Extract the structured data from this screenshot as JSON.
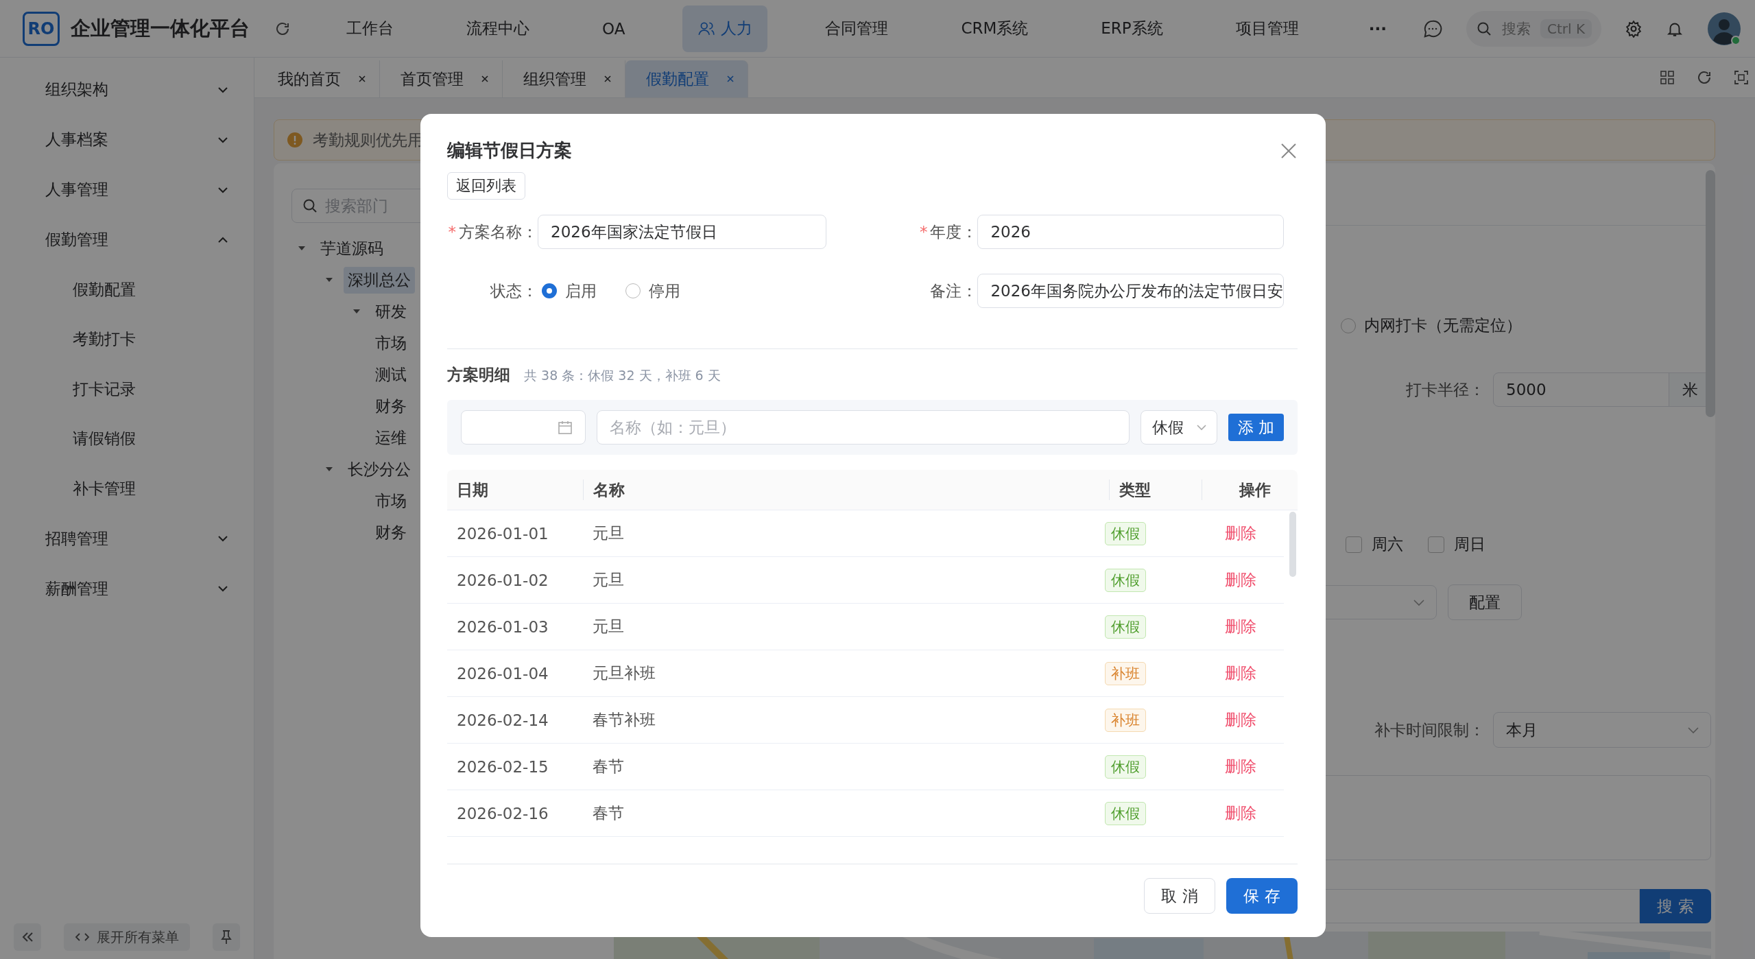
{
  "app": {
    "logo": "RO",
    "title": "企业管理一体化平台"
  },
  "top_nav": [
    {
      "label": "工作台",
      "kind": "text",
      "selected": false
    },
    {
      "label": "流程中心",
      "kind": "text",
      "selected": false
    },
    {
      "label": "OA",
      "kind": "text",
      "selected": false
    },
    {
      "label": "人力",
      "kind": "with-icon",
      "selected": true
    },
    {
      "label": "合同管理",
      "kind": "text",
      "selected": false
    },
    {
      "label": "CRM系统",
      "kind": "text",
      "selected": false
    },
    {
      "label": "ERP系统",
      "kind": "text",
      "selected": false
    },
    {
      "label": "项目管理",
      "kind": "text",
      "selected": false
    },
    {
      "label": "···",
      "kind": "more",
      "selected": false
    }
  ],
  "search": {
    "placeholder": "搜索",
    "shortcut": "Ctrl K"
  },
  "tabs": [
    {
      "label": "我的首页",
      "selected": false
    },
    {
      "label": "首页管理",
      "selected": false
    },
    {
      "label": "组织管理",
      "selected": false
    },
    {
      "label": "假勤配置",
      "selected": true
    }
  ],
  "sidebar": {
    "items": [
      {
        "label": "组织架构",
        "expanded": false
      },
      {
        "label": "人事档案",
        "expanded": false
      },
      {
        "label": "人事管理",
        "expanded": false
      },
      {
        "label": "假勤管理",
        "expanded": true,
        "children": [
          {
            "label": "假勤配置"
          },
          {
            "label": "考勤打卡"
          },
          {
            "label": "打卡记录"
          },
          {
            "label": "请假销假"
          },
          {
            "label": "补卡管理"
          }
        ]
      },
      {
        "label": "招聘管理",
        "expanded": false
      },
      {
        "label": "薪酬管理",
        "expanded": false
      }
    ],
    "expand_all": "展开所有菜单"
  },
  "page": {
    "notice": "考勤规则优先用",
    "dept_search": {
      "placeholder": "搜索部门"
    },
    "dept_tree": [
      {
        "label": "芋道源码",
        "expanded": true,
        "selected": false,
        "children": [
          {
            "label": "深圳总公",
            "expanded": true,
            "selected": true,
            "children": [
              {
                "label": "研发",
                "expanded": true,
                "selected": false
              },
              {
                "label": "市场",
                "selected": false
              },
              {
                "label": "测试",
                "selected": false
              },
              {
                "label": "财务",
                "selected": false
              },
              {
                "label": "运维",
                "selected": false
              }
            ]
          },
          {
            "label": "长沙分公",
            "expanded": true,
            "selected": false,
            "children": [
              {
                "label": "市场",
                "selected": false
              },
              {
                "label": "财务",
                "selected": false
              }
            ]
          }
        ]
      }
    ],
    "checkin_mode": {
      "label": "内网打卡（无需定位）",
      "selected": false
    },
    "radius": {
      "label": "打卡半径：",
      "value": "5000",
      "unit": "米"
    },
    "weekend": [
      {
        "label": "周六",
        "checked": false
      },
      {
        "label": "周日",
        "checked": false
      }
    ],
    "config_button": "配置",
    "makeup_limit": {
      "label": "补卡时间限制：",
      "value": "本月"
    },
    "map_search_button": "搜 索"
  },
  "dialog": {
    "title": "编辑节假日方案",
    "back_button": "返回列表",
    "name": {
      "mark": "*",
      "label": "方案名称：",
      "value": "2026年国家法定节假日"
    },
    "year": {
      "mark": "*",
      "label": "年度：",
      "value": "2026"
    },
    "status": {
      "label": "状态：",
      "options": [
        {
          "label": "启用",
          "selected": true
        },
        {
          "label": "停用",
          "selected": false
        }
      ]
    },
    "remark": {
      "label": "备注：",
      "value": "2026年国务院办公厅发布的法定节假日安"
    },
    "detail_title": "方案明细",
    "summary": "共 38 条：休假 32 天，补班 6 天",
    "add_bar": {
      "name_placeholder": "名称（如：元旦）",
      "type_value": "休假",
      "add_button": "添 加"
    },
    "columns": [
      "日期",
      "名称",
      "类型",
      "操作"
    ],
    "rows": [
      {
        "date": "2026-01-01",
        "name": "元旦",
        "type": "休假",
        "kind": "rest",
        "action": "删除"
      },
      {
        "date": "2026-01-02",
        "name": "元旦",
        "type": "休假",
        "kind": "rest",
        "action": "删除"
      },
      {
        "date": "2026-01-03",
        "name": "元旦",
        "type": "休假",
        "kind": "rest",
        "action": "删除"
      },
      {
        "date": "2026-01-04",
        "name": "元旦补班",
        "type": "补班",
        "kind": "work",
        "action": "删除"
      },
      {
        "date": "2026-02-14",
        "name": "春节补班",
        "type": "补班",
        "kind": "work",
        "action": "删除"
      },
      {
        "date": "2026-02-15",
        "name": "春节",
        "type": "休假",
        "kind": "rest",
        "action": "删除"
      },
      {
        "date": "2026-02-16",
        "name": "春节",
        "type": "休假",
        "kind": "rest",
        "action": "删除"
      }
    ],
    "cancel_button": "取 消",
    "save_button": "保 存"
  }
}
